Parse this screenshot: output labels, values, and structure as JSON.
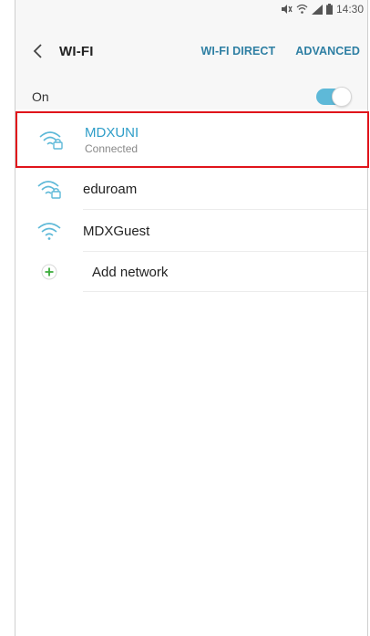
{
  "status_bar": {
    "time": "14:30"
  },
  "header": {
    "title": "WI-FI",
    "actions": [
      {
        "label": "WI-FI DIRECT"
      },
      {
        "label": "ADVANCED"
      }
    ]
  },
  "wifi_toggle": {
    "label": "On",
    "enabled": true
  },
  "networks": [
    {
      "name": "MDXUNI",
      "status": "Connected",
      "secured": true
    },
    {
      "name": "eduroam",
      "status": "",
      "secured": true
    },
    {
      "name": "MDXGuest",
      "status": "",
      "secured": false
    }
  ],
  "add_network": {
    "label": "Add network"
  },
  "colors": {
    "accent": "#2e9dc8",
    "highlight_border": "#e0141b",
    "toggle_on": "#5eb9d8",
    "add_icon": "#3aab3a"
  }
}
